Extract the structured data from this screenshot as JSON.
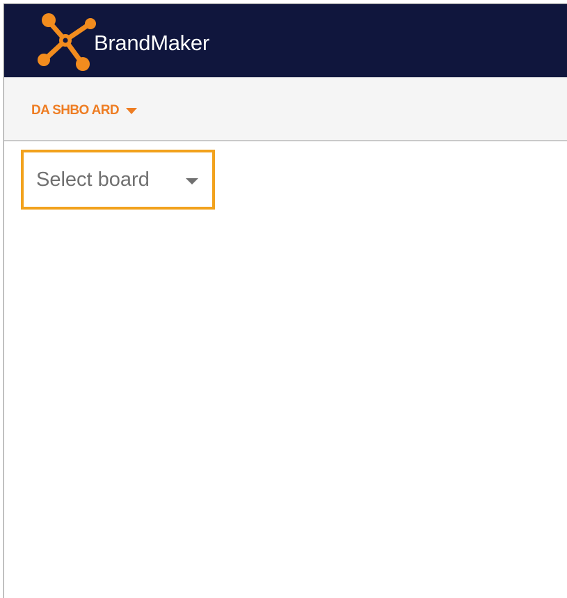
{
  "header": {
    "brand_name": "BrandMaker",
    "logo_icon": "brandmaker-logo-icon",
    "background_color": "#10163d",
    "logo_color": "#f28c1e"
  },
  "nav": {
    "dashboard_label": "DA SHBO ARD",
    "caret_icon": "caret-down-icon",
    "accent_color": "#ee7d23"
  },
  "board_select": {
    "placeholder": "Select board",
    "caret_icon": "caret-down-icon",
    "highlight_color": "#f2a21d"
  }
}
